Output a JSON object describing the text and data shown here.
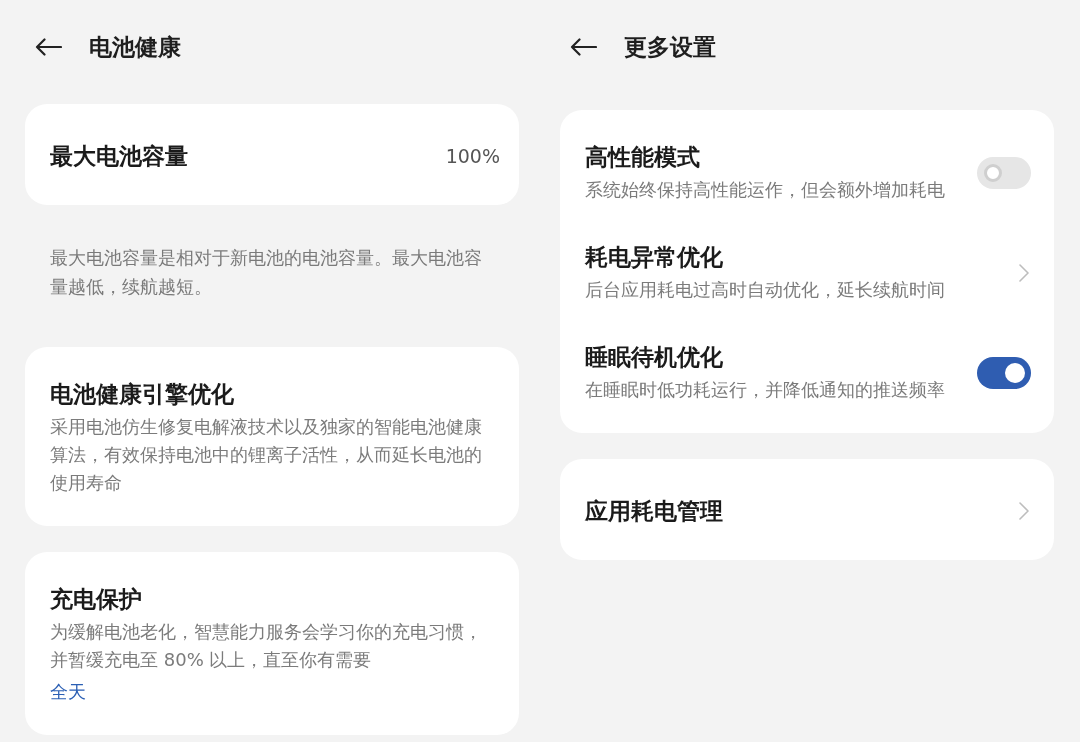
{
  "screens": [
    {
      "title": "电池健康",
      "blocks": [
        {
          "kind": "card",
          "rows": [
            {
              "kind": "value",
              "title": "最大电池容量",
              "value": "100%"
            }
          ]
        },
        {
          "kind": "note",
          "text": "最大电池容量是相对于新电池的电池容量。最大电池容量越低，续航越短。"
        },
        {
          "kind": "card",
          "rows": [
            {
              "kind": "info",
              "title": "电池健康引擎优化",
              "description": "采用电池仿生修复电解液技术以及独家的智能电池健康算法，有效保持电池中的锂离子活性，从而延长电池的使用寿命"
            }
          ]
        },
        {
          "kind": "card",
          "rows": [
            {
              "kind": "info",
              "title": "充电保护",
              "description": "为缓解电池老化，智慧能力服务会学习你的充电习惯，并暂缓充电至 80% 以上，直至你有需要",
              "link": "全天"
            }
          ]
        }
      ]
    },
    {
      "title": "更多设置",
      "blocks": [
        {
          "kind": "card",
          "rows": [
            {
              "kind": "switch",
              "title": "高性能模式",
              "description": "系统始终保持高性能运作，但会额外增加耗电",
              "on": false
            },
            {
              "kind": "nav",
              "title": "耗电异常优化",
              "description": "后台应用耗电过高时自动优化，延长续航时间"
            },
            {
              "kind": "switch",
              "title": "睡眠待机优化",
              "description": "在睡眠时低功耗运行，并降低通知的推送频率",
              "on": true
            }
          ]
        },
        {
          "kind": "card",
          "rows": [
            {
              "kind": "nav",
              "title": "应用耗电管理"
            }
          ]
        }
      ]
    }
  ]
}
